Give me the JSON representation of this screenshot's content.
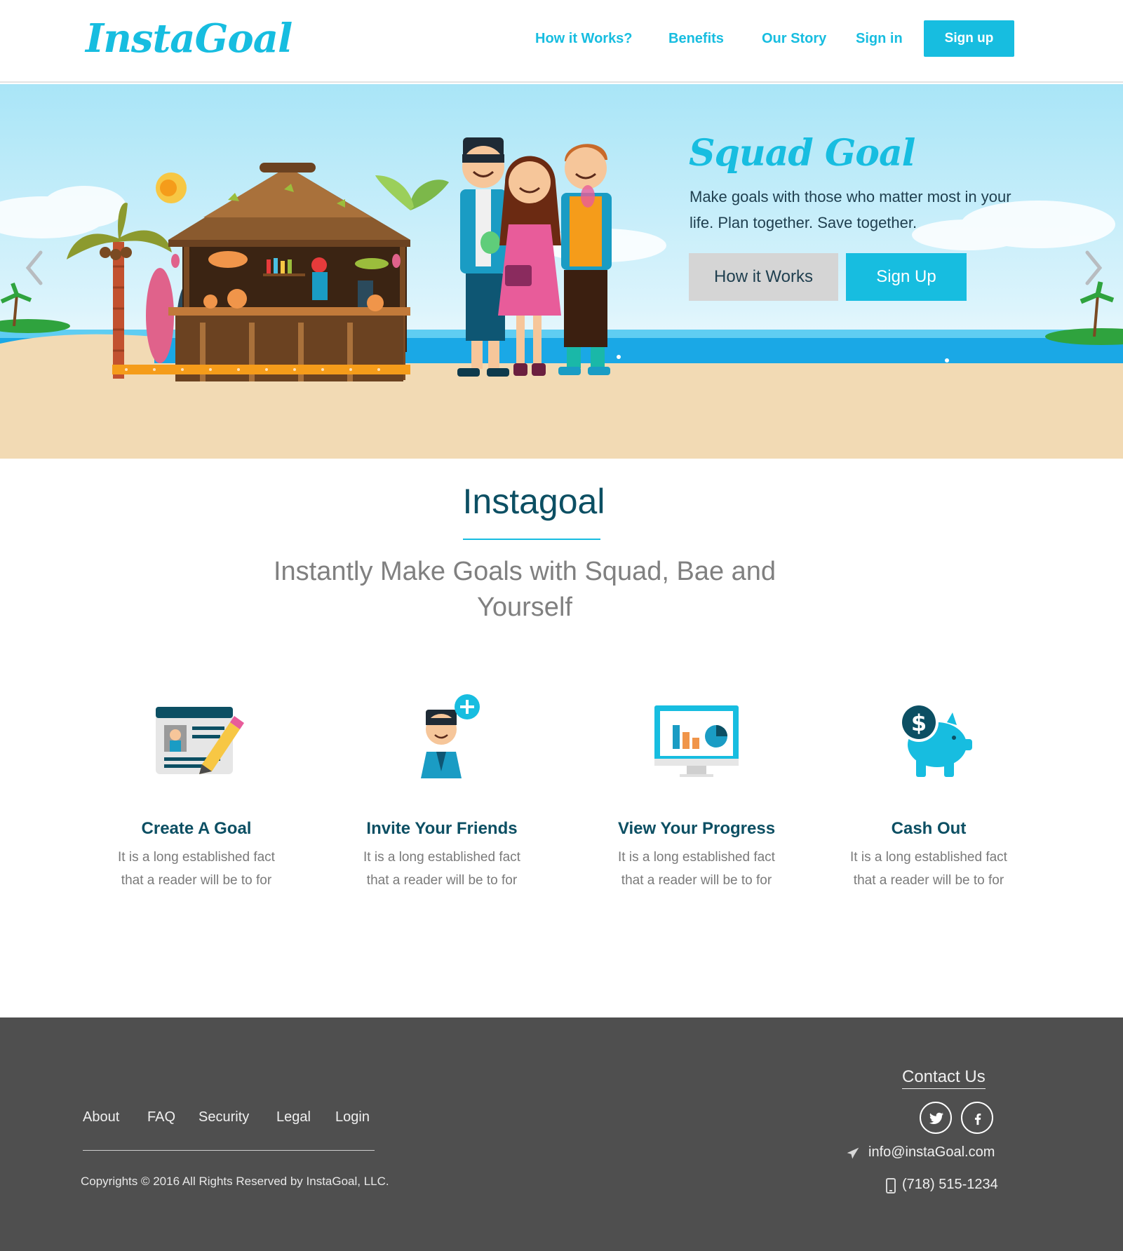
{
  "header": {
    "logo": "InstaGoal",
    "nav": [
      "How it Works?",
      "Benefits",
      "Our Story",
      "Sign in"
    ],
    "signup_label": "Sign up"
  },
  "hero": {
    "title": "Squad Goal",
    "text": "Make goals with those who matter most in your life. Plan together. Save together.",
    "btn_how": "How it Works",
    "btn_signup": "Sign Up"
  },
  "intro": {
    "title": "Instagoal",
    "subtitle": "Instantly Make Goals with Squad, Bae and Yourself"
  },
  "features": [
    {
      "title": "Create A Goal",
      "desc": "It is a long established fact that a reader will be to for",
      "icon": "id-card-pencil-icon"
    },
    {
      "title": "Invite Your Friends",
      "desc": "It is a long established fact that a reader will be to for",
      "icon": "add-friend-icon"
    },
    {
      "title": "View Your Progress",
      "desc": "It is a long established fact that a reader will be to for",
      "icon": "monitor-chart-icon"
    },
    {
      "title": "Cash Out",
      "desc": "It is a long established fact that a reader will be to for",
      "icon": "piggy-bank-icon"
    }
  ],
  "footer": {
    "links": [
      "About",
      "FAQ",
      "Security",
      "Legal",
      "Login"
    ],
    "copyright": "Copyrights © 2016 All Rights Reserved by InstaGoal, LLC.",
    "contact_title": "Contact Us",
    "email": "info@instaGoal.com",
    "phone": "(718) 515-1234"
  },
  "colors": {
    "accent": "#17bde0",
    "dark_teal": "#0c4f63",
    "footer_bg": "#4f4f4f"
  }
}
